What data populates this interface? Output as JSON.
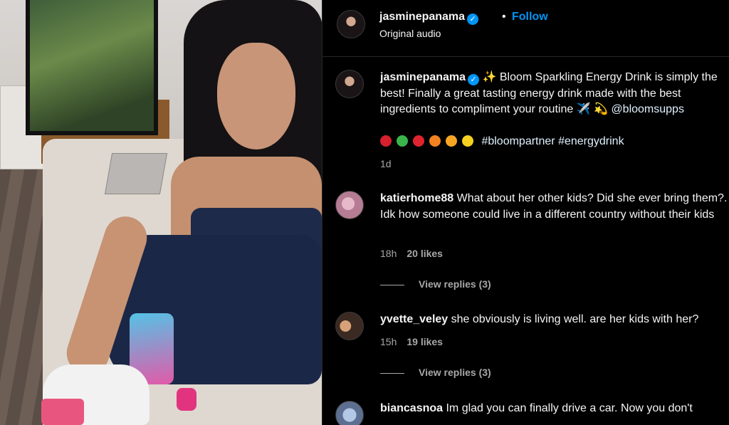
{
  "post": {
    "username": "jasminepanama",
    "follow_label": "Follow",
    "separator": "•",
    "audio": "Original audio",
    "verified_glyph": "✓"
  },
  "caption": {
    "username": "jasminepanama",
    "text": "✨ Bloom Sparkling Energy Drink is simply the best! Finally a great tasting energy drink made with the best ingredients to compliment your routine ✈️ 💫 ",
    "mention": "@bloomsupps",
    "emoji_icons": [
      "cherry-icon",
      "watermelon-icon",
      "strawberry-icon",
      "orange-icon",
      "mango-icon",
      "lemon-icon"
    ],
    "emoji_colors": [
      "#d6202e",
      "#3bb54a",
      "#e0242f",
      "#f58220",
      "#f6a623",
      "#f5d020"
    ],
    "hashtags": "#bloompartner #energydrink",
    "time": "1d"
  },
  "comments": [
    {
      "username": "katierhome88",
      "text": "What about her other kids? Did she ever bring them?. Idk how someone could live in a different country without their kids",
      "time": "18h",
      "likes": "20 likes",
      "replies": "View replies (3)"
    },
    {
      "username": "yvette_veley",
      "text": "she obviously is living well. are her kids with her?",
      "time": "15h",
      "likes": "19 likes",
      "replies": "View replies (3)"
    },
    {
      "username": "biancasnoa",
      "text": "Im glad you can finally drive a car. Now you don't"
    }
  ]
}
